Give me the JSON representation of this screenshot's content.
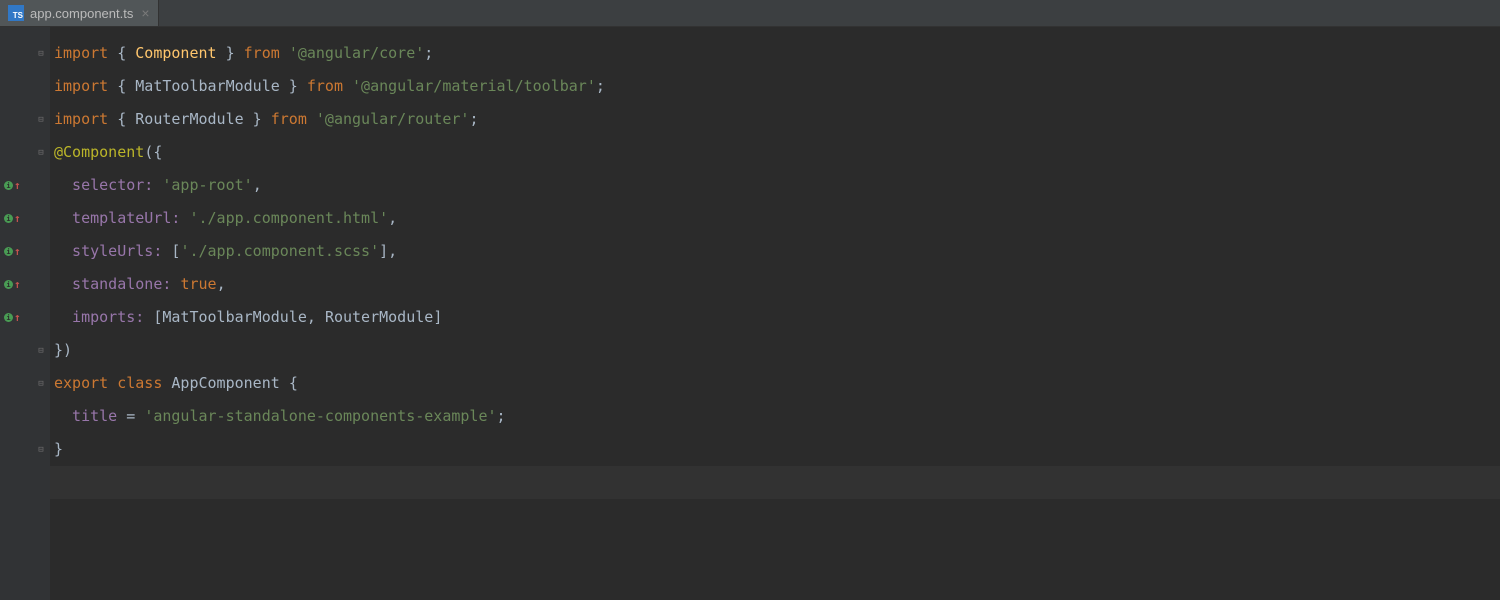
{
  "tab": {
    "filename": "app.component.ts",
    "icon_label": "TS"
  },
  "gutter": {
    "vcs_marks": [
      false,
      false,
      false,
      false,
      true,
      true,
      true,
      true,
      true,
      false,
      false,
      false,
      false,
      false
    ]
  },
  "code": {
    "lines": [
      {
        "tokens": [
          {
            "t": "import ",
            "c": "kw"
          },
          {
            "t": "{ ",
            "c": "punct"
          },
          {
            "t": "Component",
            "c": "importname"
          },
          {
            "t": " } ",
            "c": "punct"
          },
          {
            "t": "from ",
            "c": "kw"
          },
          {
            "t": "'@angular/core'",
            "c": "str"
          },
          {
            "t": ";",
            "c": "punct"
          }
        ],
        "fold": "open"
      },
      {
        "tokens": [
          {
            "t": "import ",
            "c": "kw"
          },
          {
            "t": "{ ",
            "c": "punct"
          },
          {
            "t": "MatToolbarModule",
            "c": "ident"
          },
          {
            "t": " } ",
            "c": "punct"
          },
          {
            "t": "from ",
            "c": "kw"
          },
          {
            "t": "'@angular/material/toolbar'",
            "c": "str"
          },
          {
            "t": ";",
            "c": "punct"
          }
        ],
        "fold": ""
      },
      {
        "tokens": [
          {
            "t": "import ",
            "c": "kw"
          },
          {
            "t": "{ ",
            "c": "punct"
          },
          {
            "t": "RouterModule",
            "c": "ident"
          },
          {
            "t": " } ",
            "c": "punct"
          },
          {
            "t": "from ",
            "c": "kw"
          },
          {
            "t": "'@angular/router'",
            "c": "str"
          },
          {
            "t": ";",
            "c": "punct"
          }
        ],
        "fold": "close"
      },
      {
        "tokens": [
          {
            "t": "@Component",
            "c": "decorator"
          },
          {
            "t": "({",
            "c": "punct"
          }
        ],
        "fold": "open"
      },
      {
        "tokens": [
          {
            "t": "  selector: ",
            "c": "prop"
          },
          {
            "t": "'app-root'",
            "c": "str"
          },
          {
            "t": ",",
            "c": "punct"
          }
        ],
        "fold": ""
      },
      {
        "tokens": [
          {
            "t": "  templateUrl: ",
            "c": "prop"
          },
          {
            "t": "'./app.component.html'",
            "c": "str"
          },
          {
            "t": ",",
            "c": "punct"
          }
        ],
        "fold": ""
      },
      {
        "tokens": [
          {
            "t": "  styleUrls: ",
            "c": "prop"
          },
          {
            "t": "[",
            "c": "punct"
          },
          {
            "t": "'./app.component.scss'",
            "c": "str"
          },
          {
            "t": "],",
            "c": "punct"
          }
        ],
        "fold": ""
      },
      {
        "tokens": [
          {
            "t": "  standalone: ",
            "c": "prop"
          },
          {
            "t": "true",
            "c": "kw"
          },
          {
            "t": ",",
            "c": "punct"
          }
        ],
        "fold": ""
      },
      {
        "tokens": [
          {
            "t": "  imports: ",
            "c": "prop"
          },
          {
            "t": "[",
            "c": "punct"
          },
          {
            "t": "MatToolbarModule",
            "c": "ident"
          },
          {
            "t": ", ",
            "c": "punct"
          },
          {
            "t": "RouterModule",
            "c": "ident"
          },
          {
            "t": "]",
            "c": "punct"
          }
        ],
        "fold": ""
      },
      {
        "tokens": [
          {
            "t": "})",
            "c": "punct"
          }
        ],
        "fold": "close"
      },
      {
        "tokens": [
          {
            "t": "export class ",
            "c": "kw"
          },
          {
            "t": "AppComponent ",
            "c": "classname"
          },
          {
            "t": "{",
            "c": "punct"
          }
        ],
        "fold": "open"
      },
      {
        "tokens": [
          {
            "t": "  title ",
            "c": "prop"
          },
          {
            "t": "= ",
            "c": "punct"
          },
          {
            "t": "'angular-standalone-components-example'",
            "c": "str"
          },
          {
            "t": ";",
            "c": "punct"
          }
        ],
        "fold": ""
      },
      {
        "tokens": [
          {
            "t": "}",
            "c": "punct"
          }
        ],
        "fold": "close"
      },
      {
        "tokens": [],
        "fold": "",
        "current": true
      }
    ]
  }
}
